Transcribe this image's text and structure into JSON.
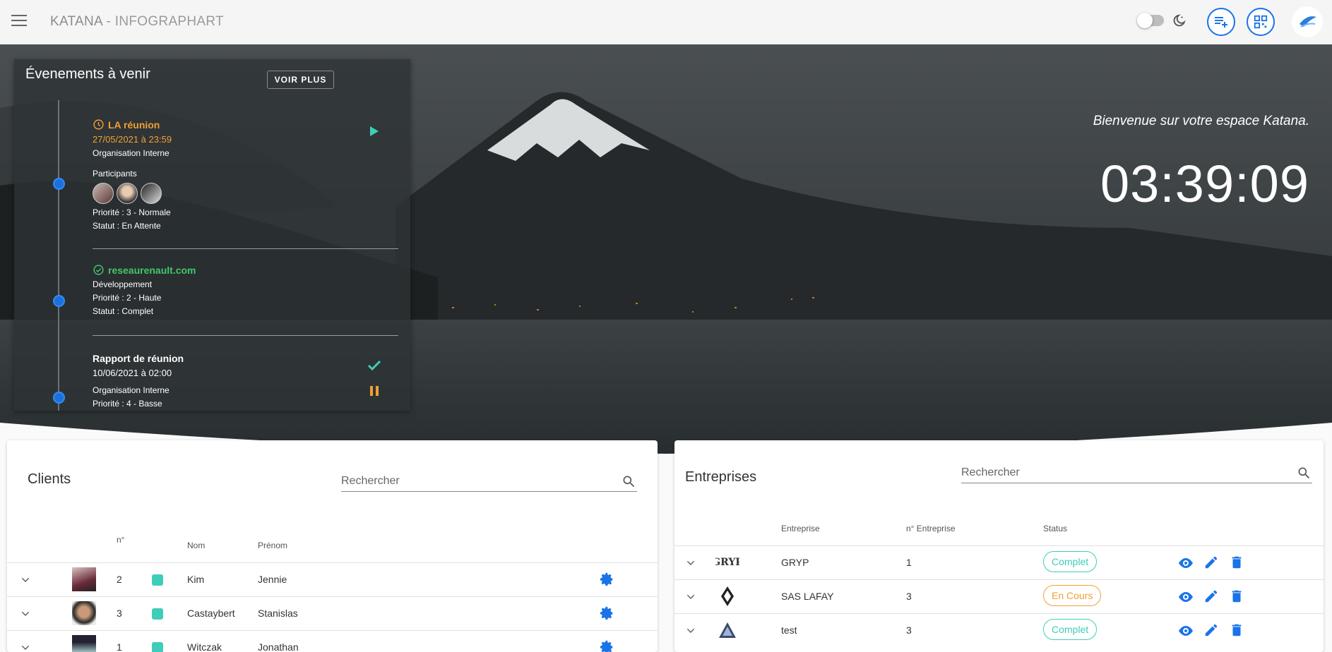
{
  "header": {
    "app_name": "KATANA",
    "app_subtitle": "- INFOGRAPHART",
    "icons": [
      "menu-icon",
      "dark-mode-toggle",
      "moon-icon",
      "playlist-add-icon",
      "qr-code-icon",
      "company-logo"
    ]
  },
  "hero": {
    "welcome": "Bienvenue sur votre espace Katana.",
    "clock": "03:39:09"
  },
  "events": {
    "title": "Évenements à venir",
    "more_label": "VOIR PLUS",
    "items": [
      {
        "name": "LA réunion",
        "status_icon": "clock-icon",
        "date": "27/05/2021 à 23:59",
        "type": "Organisation Interne",
        "participants_label": "Participants",
        "priority": "Priorité : 3 - Normale",
        "status": "Statut : En Attente"
      },
      {
        "name": "reseaurenault.com",
        "status_icon": "check-circle-icon",
        "type": "Développement",
        "priority": "Priorité : 2 - Haute",
        "status": "Statut : Complet"
      },
      {
        "name": "Rapport de réunion",
        "date": "10/06/2021 à 02:00",
        "type": "Organisation Interne",
        "priority": "Priorité : 4 - Basse"
      }
    ]
  },
  "clients": {
    "title": "Clients",
    "search_placeholder": "Rechercher",
    "columns": {
      "num": "n°",
      "nom": "Nom",
      "prenom": "Prénom"
    },
    "rows": [
      {
        "num": "2",
        "nom": "Kim",
        "prenom": "Jennie",
        "color": "#3ecdb8"
      },
      {
        "num": "3",
        "nom": "Castaybert",
        "prenom": "Stanislas",
        "color": "#3ecdb8"
      },
      {
        "num": "1",
        "nom": "Witczak",
        "prenom": "Jonathan",
        "color": "#3ecdb8"
      }
    ]
  },
  "entreprises": {
    "title": "Entreprises",
    "search_placeholder": "Rechercher",
    "columns": {
      "entreprise": "Entreprise",
      "num": "n° Entreprise",
      "status": "Status"
    },
    "rows": [
      {
        "logo_text": "GRYP",
        "name": "GRYP",
        "num": "1",
        "status": "Complet"
      },
      {
        "logo_text": "",
        "name": "SAS LAFAY",
        "num": "3",
        "status": "En Cours"
      },
      {
        "logo_text": "",
        "name": "test",
        "num": "3",
        "status": "Complet"
      }
    ]
  },
  "colors": {
    "accent": "#1a73e8",
    "teal": "#3ecdb8",
    "orange": "#f0a035",
    "green": "#42c86b"
  }
}
